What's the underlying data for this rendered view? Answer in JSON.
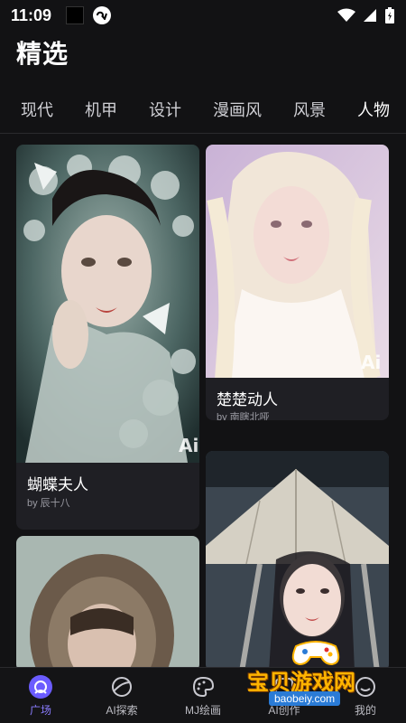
{
  "status": {
    "time": "11:09"
  },
  "header": {
    "title": "精选"
  },
  "tabs": [
    {
      "label": "现代"
    },
    {
      "label": "机甲"
    },
    {
      "label": "设计"
    },
    {
      "label": "漫画风"
    },
    {
      "label": "风景"
    },
    {
      "label": "人物",
      "active": true
    }
  ],
  "cards": [
    {
      "title": "蝴蝶夫人",
      "author": "by 辰十八"
    },
    {
      "title": "楚楚动人",
      "author": "by 南瞎北哑"
    },
    {
      "title": "",
      "author": ""
    },
    {
      "title": "",
      "author": ""
    }
  ],
  "nav": [
    {
      "label": "广场",
      "icon": "plaza-icon",
      "active": true
    },
    {
      "label": "AI探索",
      "icon": "explore-icon"
    },
    {
      "label": "MJ绘画",
      "icon": "palette-icon"
    },
    {
      "label": "AI创作",
      "icon": "create-icon"
    },
    {
      "label": "我的",
      "icon": "profile-icon"
    }
  ],
  "watermark": {
    "text": "宝贝游戏网",
    "url": "baobeiy.com"
  },
  "colors": {
    "background": "#121214",
    "card": "#1f1f24",
    "accent": "#8a7cff"
  }
}
